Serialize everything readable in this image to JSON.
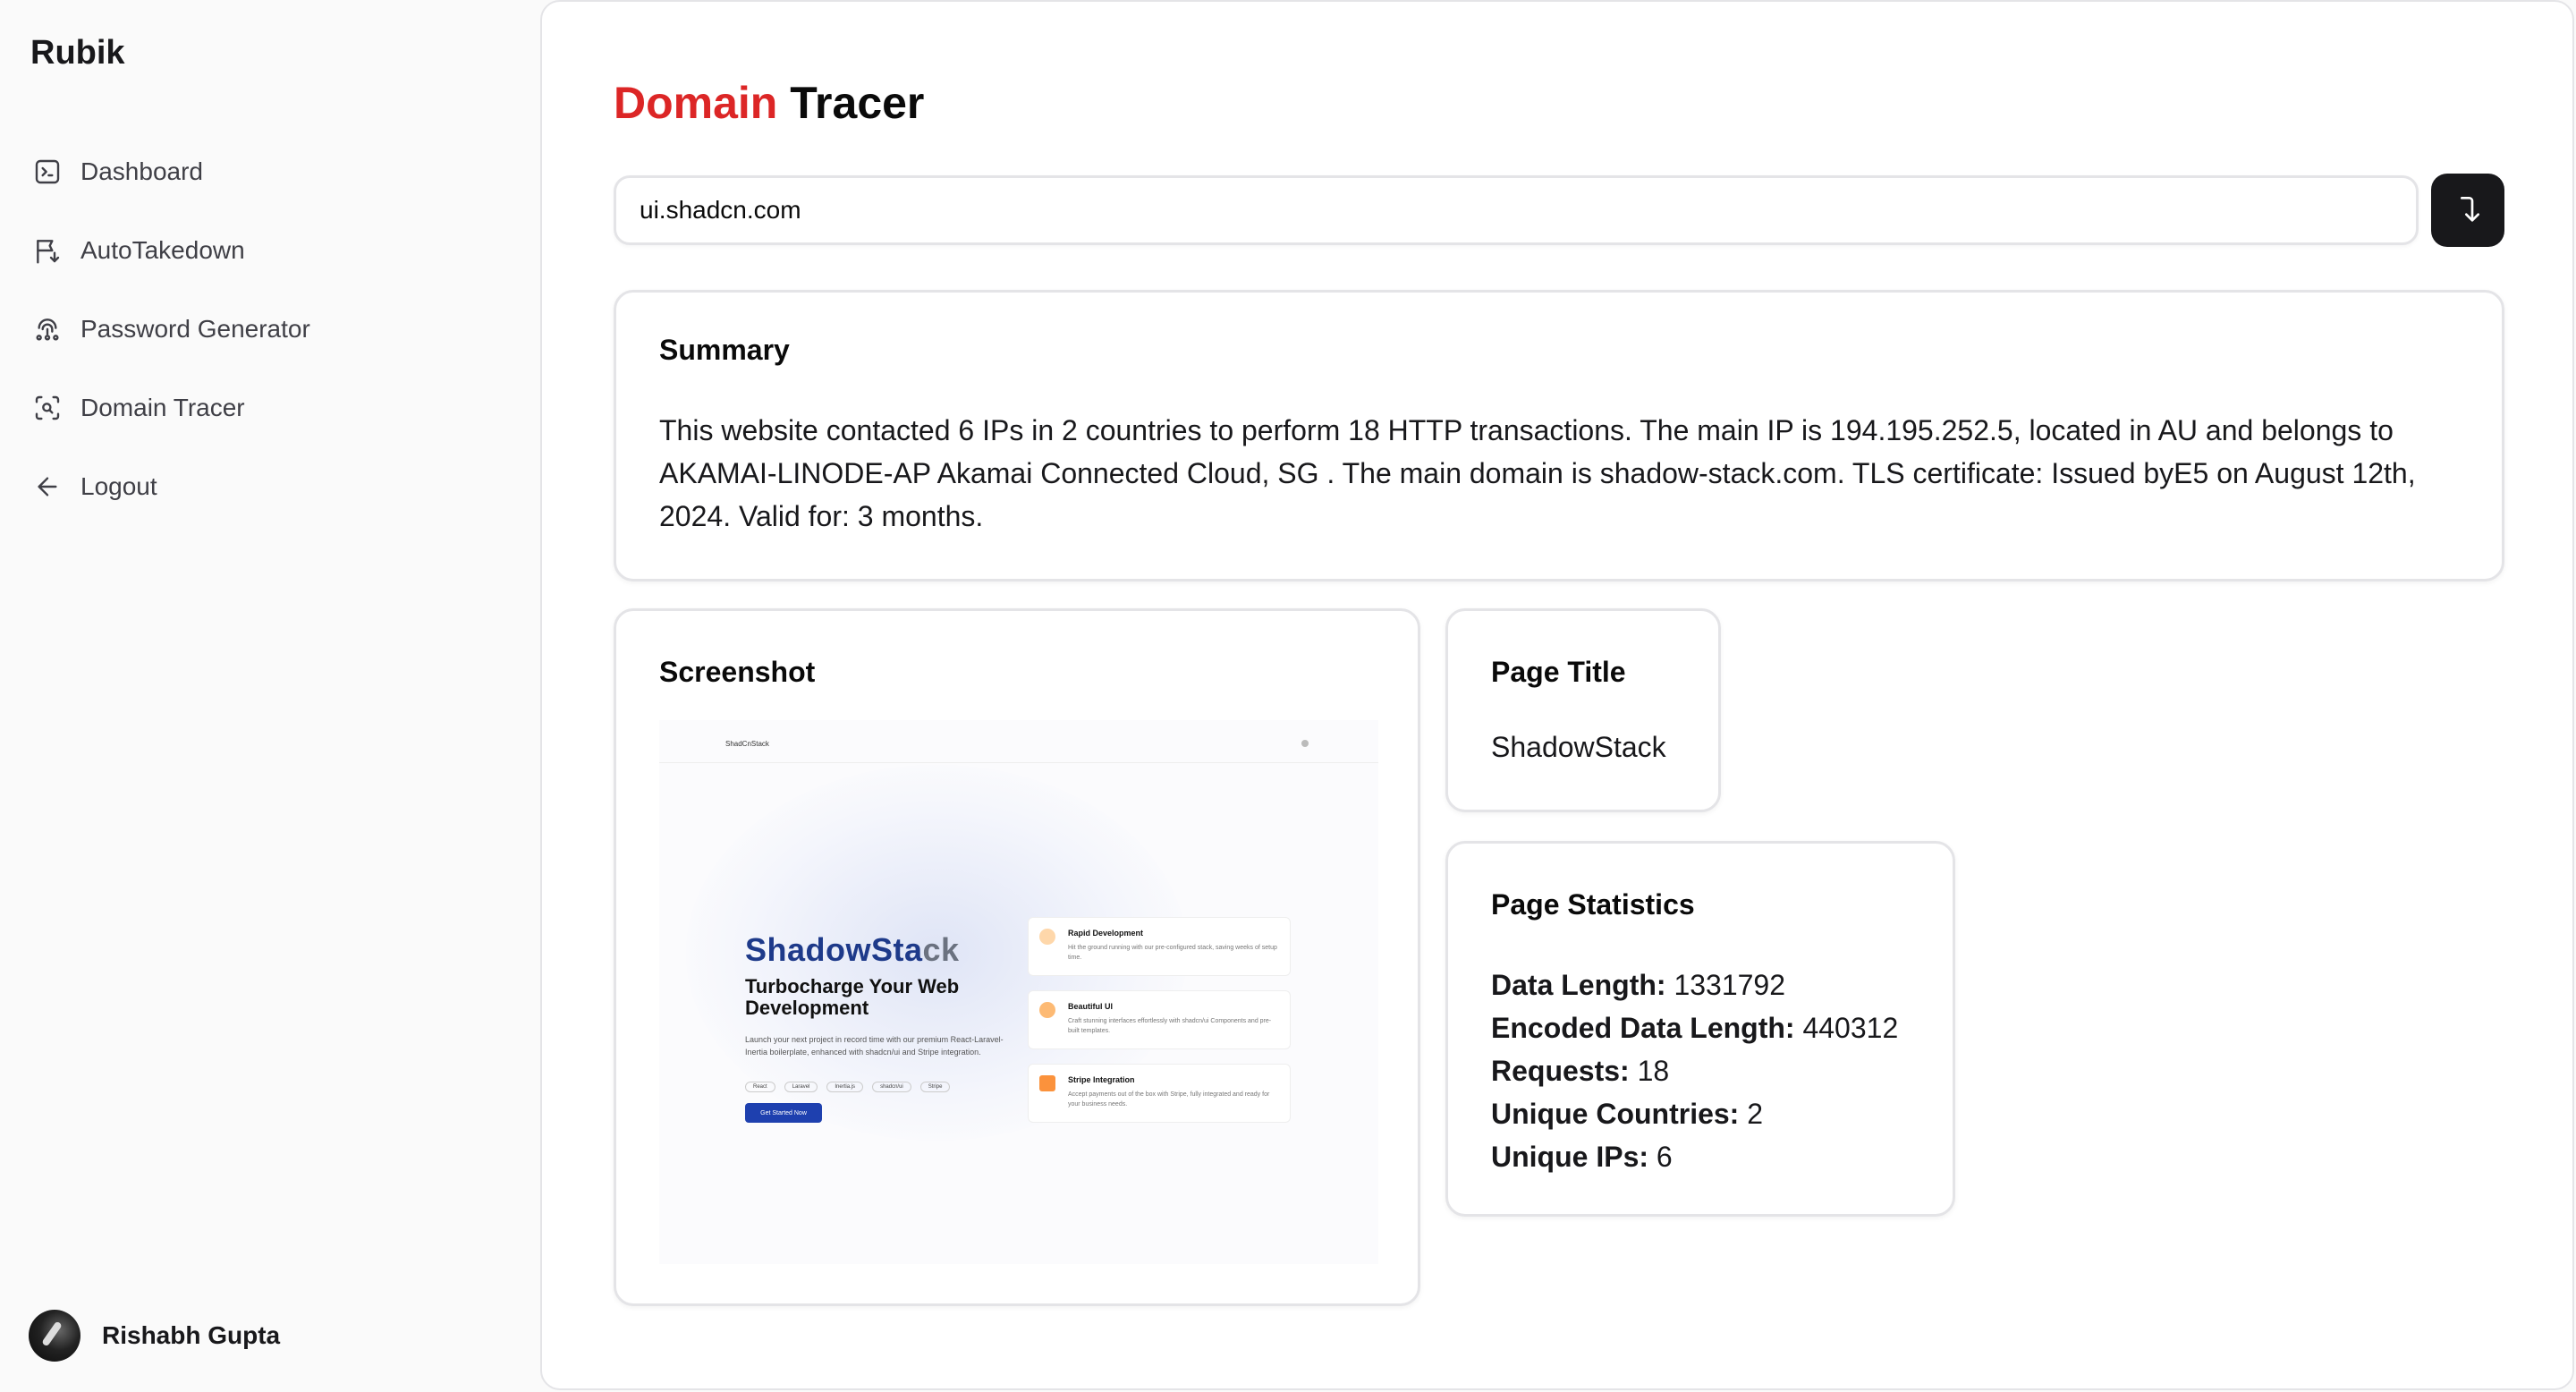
{
  "sidebar": {
    "brand": "Rubik",
    "items": [
      {
        "label": "Dashboard",
        "icon": "terminal-square-icon"
      },
      {
        "label": "AutoTakedown",
        "icon": "flag-arrow-icon"
      },
      {
        "label": "Password Generator",
        "icon": "fingerprint-icon"
      },
      {
        "label": "Domain Tracer",
        "icon": "scan-search-icon"
      },
      {
        "label": "Logout",
        "icon": "arrow-left-icon"
      }
    ],
    "user": {
      "name": "Rishabh Gupta"
    }
  },
  "header": {
    "title_accent": "Domain",
    "title_rest": "Tracer"
  },
  "search": {
    "value": "ui.shadcn.com",
    "button_icon": "corner-right-down-icon"
  },
  "summary": {
    "title": "Summary",
    "text": "This website contacted 6 IPs in 2 countries to perform 18 HTTP transactions. The main IP is 194.195.252.5, located in AU and belongs to AKAMAI-LINODE-AP Akamai Connected Cloud, SG . The main domain is shadow-stack.com. TLS certificate: Issued byE5 on August 12th, 2024. Valid for: 3 months."
  },
  "screenshot": {
    "title": "Screenshot",
    "preview": {
      "nav_brand": "ShadCnStack",
      "brand_main": "ShadowSta",
      "brand_tail": "ck",
      "headline": "Turbocharge Your Web Development",
      "sub": "Launch your next project in record time with our premium React-Laravel-Inertia boilerplate, enhanced with shadcn/ui and Stripe integration.",
      "tags": [
        "React",
        "Laravel",
        "Inertia.js",
        "shadcn/ui",
        "Stripe"
      ],
      "cta": "Get Started Now",
      "features": [
        {
          "title": "Rapid Development",
          "desc": "Hit the ground running with our pre-configured stack, saving weeks of setup time.",
          "color": "#f97316"
        },
        {
          "title": "Beautiful UI",
          "desc": "Craft stunning interfaces effortlessly with shadcn/ui Components and pre-built templates.",
          "color": "#fb923c"
        },
        {
          "title": "Stripe Integration",
          "desc": "Accept payments out of the box with Stripe, fully integrated and ready for your business needs.",
          "color": "#ea580c"
        }
      ]
    }
  },
  "page_title": {
    "title": "Page Title",
    "value": "ShadowStack"
  },
  "stats": {
    "title": "Page Statistics",
    "rows": [
      {
        "label": "Data Length:",
        "value": "1331792"
      },
      {
        "label": "Encoded Data Length:",
        "value": "440312"
      },
      {
        "label": "Requests:",
        "value": "18"
      },
      {
        "label": "Unique Countries:",
        "value": "2"
      },
      {
        "label": "Unique IPs:",
        "value": "6"
      }
    ]
  }
}
